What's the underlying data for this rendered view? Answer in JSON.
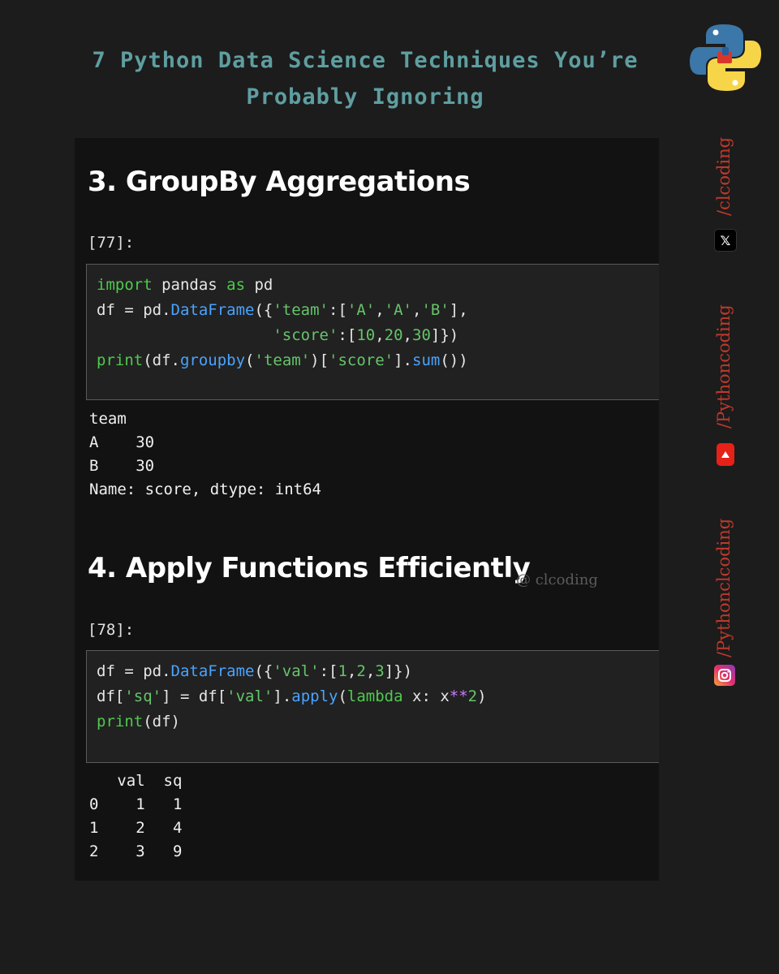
{
  "header": {
    "title": "7 Python Data Science Techniques You’re Probably Ignoring"
  },
  "sections": [
    {
      "heading": "3. GroupBy Aggregations",
      "prompt": "[77]:",
      "code": {
        "l1": {
          "a": "import",
          "b": " pandas ",
          "c": "as",
          "d": " pd"
        },
        "l2": {
          "a": "df = pd.",
          "b": "DataFrame",
          "c": "({",
          "d": "'team'",
          "e": ":[",
          "f": "'A'",
          "g": ",",
          "h": "'A'",
          "i": ",",
          "j": "'B'",
          "k": "],"
        },
        "l3": {
          "a": "                   ",
          "b": "'score'",
          "c": ":[",
          "d": "10",
          "e": ",",
          "f": "20",
          "g": ",",
          "h": "30",
          "i": "]})"
        },
        "l4": {
          "a": "print",
          "b": "(df.",
          "c": "groupby",
          "d": "(",
          "e": "'team'",
          "f": ")[",
          "g": "'score'",
          "h": "].",
          "i": "sum",
          "j": "())"
        }
      },
      "output": {
        "l1": "team",
        "l2": "A    30",
        "l3": "B    30",
        "l4": "Name: score, dtype: int64"
      }
    },
    {
      "heading": "4. Apply Functions Efficiently",
      "prompt": "[78]:",
      "code": {
        "l1": {
          "a": "df = pd.",
          "b": "DataFrame",
          "c": "({",
          "d": "'val'",
          "e": ":[",
          "f": "1",
          "g": ",",
          "h": "2",
          "i": ",",
          "j": "3",
          "k": "]})"
        },
        "l2": {
          "a": "df[",
          "b": "'sq'",
          "c": "] = df[",
          "d": "'val'",
          "e": "].",
          "f": "apply",
          "g": "(",
          "h": "lambda",
          "i": " x: x",
          "j": "**",
          "k": "2",
          "l": ")"
        },
        "l3": {
          "a": "print",
          "b": "(df)"
        }
      },
      "output": {
        "l1": "   val  sq",
        "l2": "0    1   1",
        "l3": "1    2   4",
        "l4": "2    3   9"
      }
    }
  ],
  "watermark": "@ clcoding",
  "social": {
    "twitter_handle": "/clcoding",
    "youtube_handle": "/Pythoncoding",
    "instagram_handle": "/Pythonclcoding",
    "twitter_icon_glyph": "𝕏",
    "twitter_icon": "x-twitter-icon",
    "youtube_icon": "youtube-icon",
    "instagram_icon": "instagram-icon"
  },
  "logo_icon": "python-logo-icon",
  "colors": {
    "title": "#5f9ea0",
    "keyword": "#4ec94e",
    "function": "#4aa3ff",
    "string": "#66c46a",
    "operator": "#c77dff",
    "side_text": "#c0392b"
  }
}
